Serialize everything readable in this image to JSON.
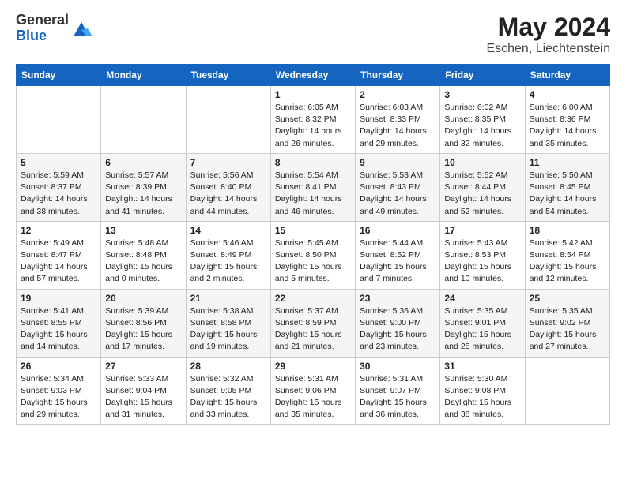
{
  "header": {
    "logo_general": "General",
    "logo_blue": "Blue",
    "month_year": "May 2024",
    "location": "Eschen, Liechtenstein"
  },
  "weekdays": [
    "Sunday",
    "Monday",
    "Tuesday",
    "Wednesday",
    "Thursday",
    "Friday",
    "Saturday"
  ],
  "rows": [
    [
      {
        "day": "",
        "info": ""
      },
      {
        "day": "",
        "info": ""
      },
      {
        "day": "",
        "info": ""
      },
      {
        "day": "1",
        "info": "Sunrise: 6:05 AM\nSunset: 8:32 PM\nDaylight: 14 hours\nand 26 minutes."
      },
      {
        "day": "2",
        "info": "Sunrise: 6:03 AM\nSunset: 8:33 PM\nDaylight: 14 hours\nand 29 minutes."
      },
      {
        "day": "3",
        "info": "Sunrise: 6:02 AM\nSunset: 8:35 PM\nDaylight: 14 hours\nand 32 minutes."
      },
      {
        "day": "4",
        "info": "Sunrise: 6:00 AM\nSunset: 8:36 PM\nDaylight: 14 hours\nand 35 minutes."
      }
    ],
    [
      {
        "day": "5",
        "info": "Sunrise: 5:59 AM\nSunset: 8:37 PM\nDaylight: 14 hours\nand 38 minutes."
      },
      {
        "day": "6",
        "info": "Sunrise: 5:57 AM\nSunset: 8:39 PM\nDaylight: 14 hours\nand 41 minutes."
      },
      {
        "day": "7",
        "info": "Sunrise: 5:56 AM\nSunset: 8:40 PM\nDaylight: 14 hours\nand 44 minutes."
      },
      {
        "day": "8",
        "info": "Sunrise: 5:54 AM\nSunset: 8:41 PM\nDaylight: 14 hours\nand 46 minutes."
      },
      {
        "day": "9",
        "info": "Sunrise: 5:53 AM\nSunset: 8:43 PM\nDaylight: 14 hours\nand 49 minutes."
      },
      {
        "day": "10",
        "info": "Sunrise: 5:52 AM\nSunset: 8:44 PM\nDaylight: 14 hours\nand 52 minutes."
      },
      {
        "day": "11",
        "info": "Sunrise: 5:50 AM\nSunset: 8:45 PM\nDaylight: 14 hours\nand 54 minutes."
      }
    ],
    [
      {
        "day": "12",
        "info": "Sunrise: 5:49 AM\nSunset: 8:47 PM\nDaylight: 14 hours\nand 57 minutes."
      },
      {
        "day": "13",
        "info": "Sunrise: 5:48 AM\nSunset: 8:48 PM\nDaylight: 15 hours\nand 0 minutes."
      },
      {
        "day": "14",
        "info": "Sunrise: 5:46 AM\nSunset: 8:49 PM\nDaylight: 15 hours\nand 2 minutes."
      },
      {
        "day": "15",
        "info": "Sunrise: 5:45 AM\nSunset: 8:50 PM\nDaylight: 15 hours\nand 5 minutes."
      },
      {
        "day": "16",
        "info": "Sunrise: 5:44 AM\nSunset: 8:52 PM\nDaylight: 15 hours\nand 7 minutes."
      },
      {
        "day": "17",
        "info": "Sunrise: 5:43 AM\nSunset: 8:53 PM\nDaylight: 15 hours\nand 10 minutes."
      },
      {
        "day": "18",
        "info": "Sunrise: 5:42 AM\nSunset: 8:54 PM\nDaylight: 15 hours\nand 12 minutes."
      }
    ],
    [
      {
        "day": "19",
        "info": "Sunrise: 5:41 AM\nSunset: 8:55 PM\nDaylight: 15 hours\nand 14 minutes."
      },
      {
        "day": "20",
        "info": "Sunrise: 5:39 AM\nSunset: 8:56 PM\nDaylight: 15 hours\nand 17 minutes."
      },
      {
        "day": "21",
        "info": "Sunrise: 5:38 AM\nSunset: 8:58 PM\nDaylight: 15 hours\nand 19 minutes."
      },
      {
        "day": "22",
        "info": "Sunrise: 5:37 AM\nSunset: 8:59 PM\nDaylight: 15 hours\nand 21 minutes."
      },
      {
        "day": "23",
        "info": "Sunrise: 5:36 AM\nSunset: 9:00 PM\nDaylight: 15 hours\nand 23 minutes."
      },
      {
        "day": "24",
        "info": "Sunrise: 5:35 AM\nSunset: 9:01 PM\nDaylight: 15 hours\nand 25 minutes."
      },
      {
        "day": "25",
        "info": "Sunrise: 5:35 AM\nSunset: 9:02 PM\nDaylight: 15 hours\nand 27 minutes."
      }
    ],
    [
      {
        "day": "26",
        "info": "Sunrise: 5:34 AM\nSunset: 9:03 PM\nDaylight: 15 hours\nand 29 minutes."
      },
      {
        "day": "27",
        "info": "Sunrise: 5:33 AM\nSunset: 9:04 PM\nDaylight: 15 hours\nand 31 minutes."
      },
      {
        "day": "28",
        "info": "Sunrise: 5:32 AM\nSunset: 9:05 PM\nDaylight: 15 hours\nand 33 minutes."
      },
      {
        "day": "29",
        "info": "Sunrise: 5:31 AM\nSunset: 9:06 PM\nDaylight: 15 hours\nand 35 minutes."
      },
      {
        "day": "30",
        "info": "Sunrise: 5:31 AM\nSunset: 9:07 PM\nDaylight: 15 hours\nand 36 minutes."
      },
      {
        "day": "31",
        "info": "Sunrise: 5:30 AM\nSunset: 9:08 PM\nDaylight: 15 hours\nand 38 minutes."
      },
      {
        "day": "",
        "info": ""
      }
    ]
  ]
}
